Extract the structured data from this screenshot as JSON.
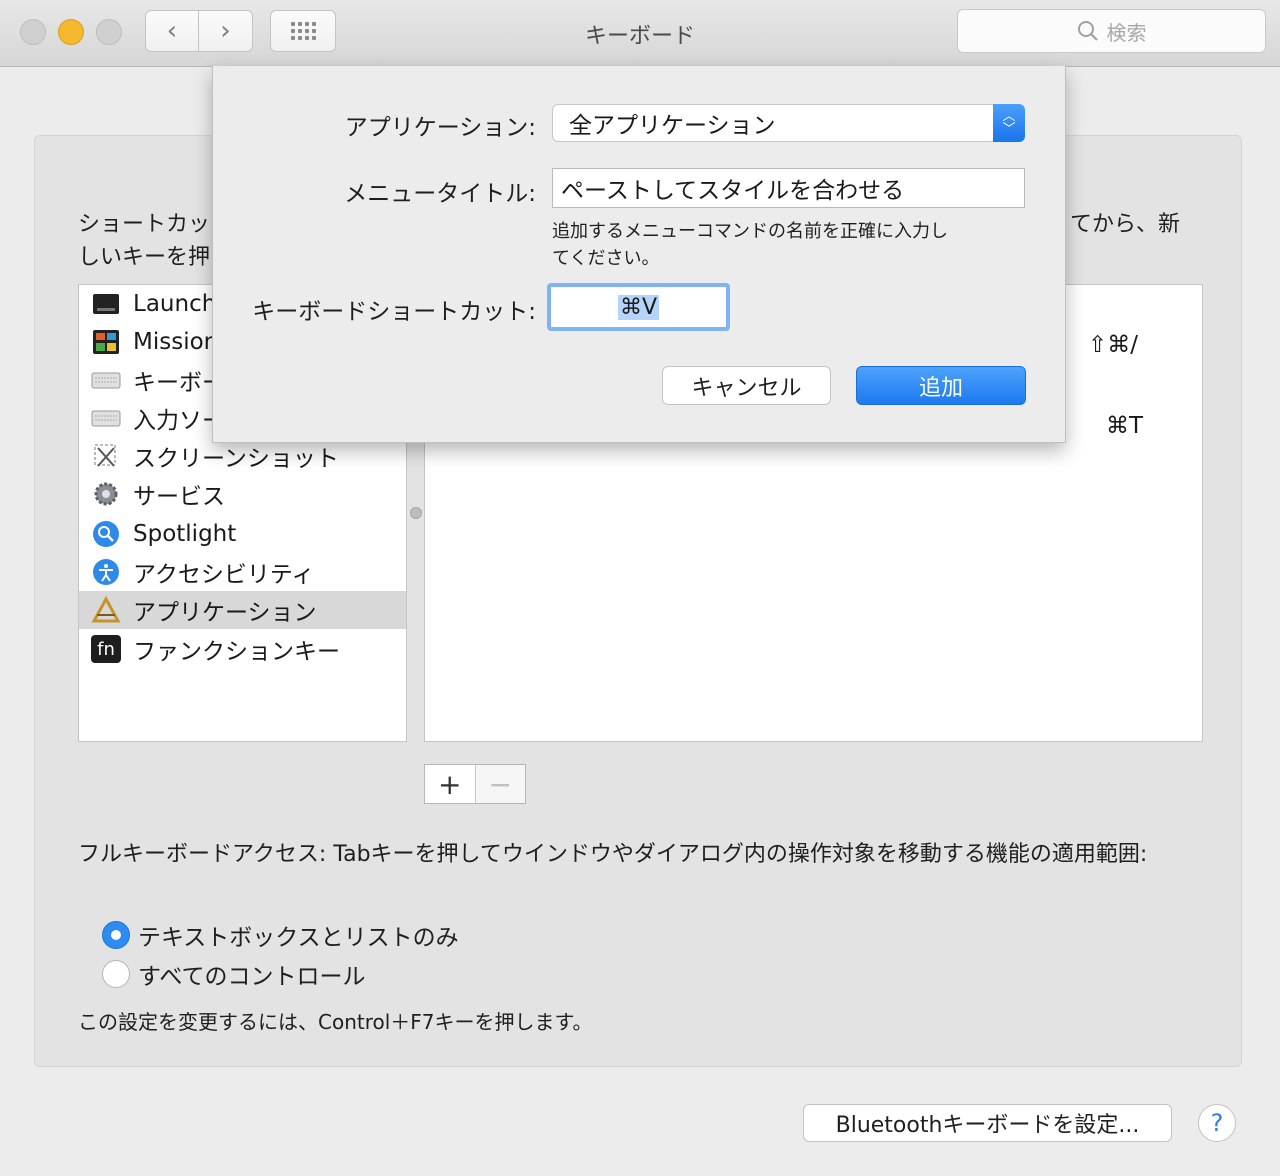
{
  "window": {
    "title": "キーボード",
    "search_placeholder": "検索"
  },
  "description": {
    "line1_start": "ショートカッ",
    "line1_end": "てから、新",
    "line2_start": "しいキーを押"
  },
  "sidebar": {
    "items": [
      {
        "label": "Launch",
        "icon": "launchpad-icon"
      },
      {
        "label": "Mission",
        "icon": "mission-control-icon"
      },
      {
        "label": "キーボー",
        "icon": "keyboard-icon"
      },
      {
        "label": "入力ソー",
        "icon": "input-source-icon"
      },
      {
        "label": "スクリーンショット",
        "icon": "screenshot-icon"
      },
      {
        "label": "サービス",
        "icon": "gear-icon"
      },
      {
        "label": "Spotlight",
        "icon": "spotlight-icon"
      },
      {
        "label": "アクセシビリティ",
        "icon": "accessibility-icon"
      },
      {
        "label": "アプリケーション",
        "icon": "app-store-icon",
        "selected": true
      },
      {
        "label": "ファンクションキー",
        "icon": "fn-key-icon"
      }
    ],
    "fn_glyph": "fn"
  },
  "shortcuts_table": {
    "shortcut_1": "⇧⌘/",
    "shortcut_2": "⌘T"
  },
  "add_remove": {
    "add": "+",
    "remove": "−"
  },
  "full_keyboard_access": {
    "text": "フルキーボードアクセス: Tabキーを押してウインドウやダイアログ内の操作対象を移動する機能の適用範囲:",
    "options": [
      {
        "label": "テキストボックスとリストのみ",
        "selected": true
      },
      {
        "label": "すべてのコントロール",
        "selected": false
      }
    ],
    "note": "この設定を変更するには、Control＋F7キーを押します。"
  },
  "bottom": {
    "bluetooth_button": "Bluetoothキーボードを設定...",
    "help": "?"
  },
  "sheet": {
    "application_label": "アプリケーション:",
    "application_value": "全アプリケーション",
    "menu_title_label": "メニュータイトル:",
    "menu_title_value": "ペーストしてスタイルを合わせる",
    "hint": "追加するメニューコマンドの名前を正確に入力してください。",
    "shortcut_label": "キーボードショートカット:",
    "shortcut_value": "⌘V",
    "cancel": "キャンセル",
    "add": "追加"
  },
  "colors": {
    "accent": "#1c79f0",
    "minimize": "#f5b82e",
    "selection": "#b4d4fb"
  }
}
